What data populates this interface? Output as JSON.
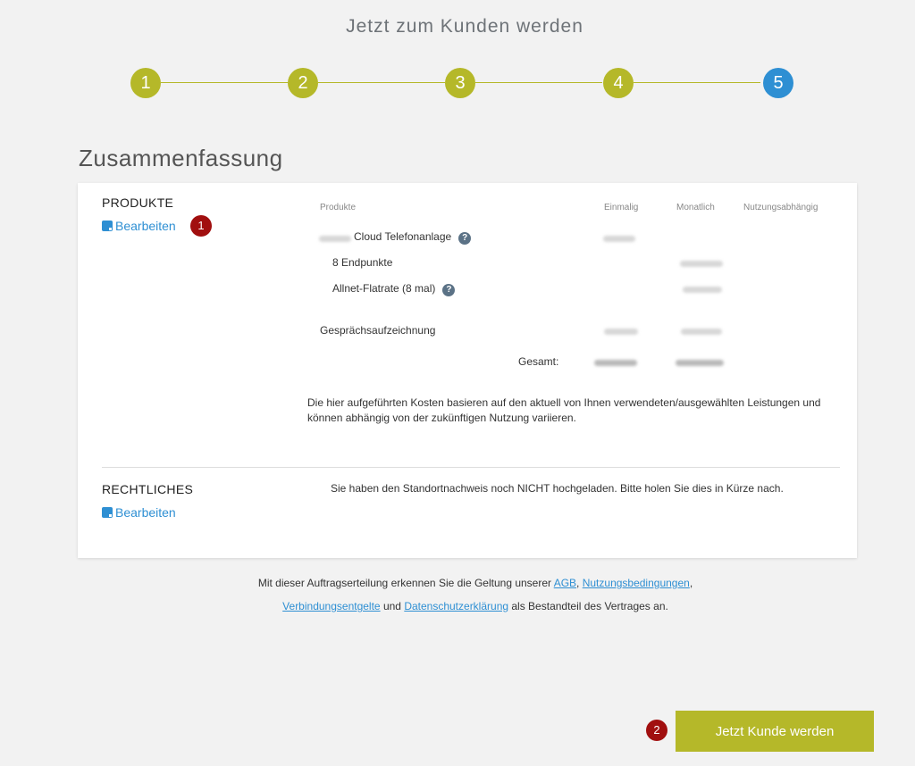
{
  "page_title": "Jetzt zum Kunden werden",
  "steps": [
    "1",
    "2",
    "3",
    "4",
    "5"
  ],
  "section_title": "Zusammenfassung",
  "produkte": {
    "label": "PRODUKTE",
    "edit_label": "Bearbeiten",
    "badge": "1",
    "columns": [
      "Produkte",
      "Einmalig",
      "Monatlich",
      "Nutzungsabhängig"
    ],
    "rows": [
      {
        "name": "Cloud Telefonanlage",
        "help": "?"
      },
      {
        "name": "8 Endpunkte"
      },
      {
        "name": "Allnet-Flatrate (8 mal)",
        "help": "?"
      },
      {
        "name": "Gesprächsaufzeichnung"
      }
    ],
    "total_label": "Gesamt:",
    "note": "Die hier aufgeführten Kosten basieren auf den aktuell von Ihnen verwendeten/ausgewählten Leistungen und können abhängig von der zukünftigen Nutzung variieren."
  },
  "rechtliches": {
    "label": "RECHTLICHES",
    "edit_label": "Bearbeiten",
    "text": "Sie haben den Standortnachweis noch NICHT hochgeladen. Bitte holen Sie dies in Kürze nach."
  },
  "footer": {
    "part1": "Mit dieser Auftragserteilung erkennen Sie die Geltung unserer ",
    "agb": "AGB",
    "sep1": ", ",
    "nutzungsbedingungen": "Nutzungsbedingungen",
    "sep2": ",",
    "verbindungsentgelte": "Verbindungsentgelte",
    "und": " und ",
    "datenschutz": "Datenschutzerklärung",
    "part2": " als Bestandteil des Vertrages an."
  },
  "cta": {
    "badge": "2",
    "label": "Jetzt Kunde werden"
  },
  "colors": {
    "accent": "#b5b829",
    "active_step": "#2e8fd3",
    "link": "#2e8fd3",
    "badge": "#a10f0f"
  }
}
